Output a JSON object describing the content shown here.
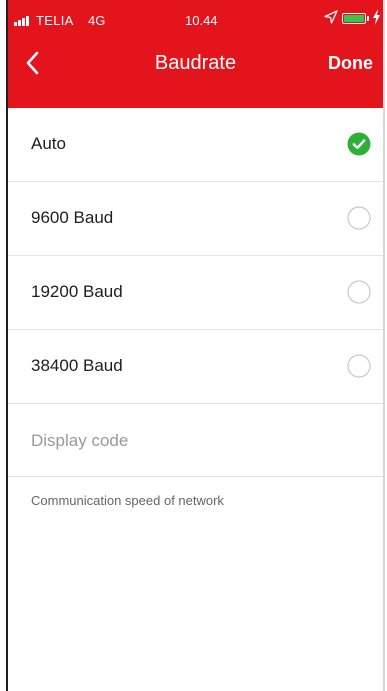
{
  "status_bar": {
    "carrier": "TELIA",
    "network": "4G",
    "time": "10.44",
    "signal_icon": "signal-bars-icon",
    "location_icon": "location-arrow-icon",
    "battery_icon": "battery-icon",
    "charging_icon": "charging-bolt-icon"
  },
  "nav": {
    "title": "Baudrate",
    "done_label": "Done",
    "back_icon": "chevron-left-icon"
  },
  "options": [
    {
      "label": "Auto",
      "selected": true
    },
    {
      "label": "9600 Baud",
      "selected": false
    },
    {
      "label": "19200 Baud",
      "selected": false
    },
    {
      "label": "38400 Baud",
      "selected": false
    }
  ],
  "display_code": {
    "label": "Display code"
  },
  "description": "Communication speed of network",
  "colors": {
    "header": "#e3141c",
    "check": "#2fae3a",
    "radio_border": "#c8c8c8",
    "battery": "#3fc14a"
  }
}
